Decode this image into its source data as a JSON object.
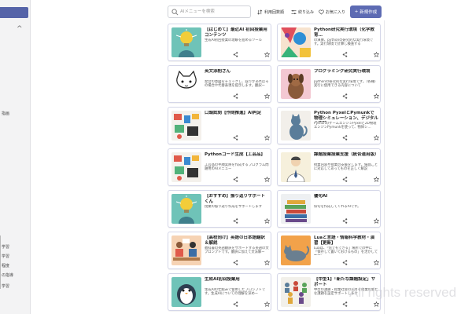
{
  "sidebar": {
    "items": [
      {
        "label": "学習"
      },
      {
        "label": "学習"
      },
      {
        "label": "程度"
      },
      {
        "label": "の指導"
      },
      {
        "label": "学習"
      }
    ],
    "fragment": "指画"
  },
  "search": {
    "placeholder": "AIメニューを検索"
  },
  "toolbar": {
    "history_label": "利用回数順",
    "filter_label": "絞り込み",
    "favorites_label": "お気に入り",
    "new_label": "新規作成"
  },
  "cards": [
    {
      "title": "【はじめて】最近AI 初回授業用コンテンツ",
      "description": "生成AI初回授業の理解を進めるツール",
      "icon": "lightbulb-head-icon"
    },
    {
      "title": "Python研究実行環境（化学教育…",
      "description": "の演算、pythonの研究的な実行環境です。実行環境で計算し検査する",
      "icon": "abstract-art-icon"
    },
    {
      "title": "英文添削さん",
      "description": "発音の意図をチェックし、誤りがあればその場合や代替表現を提示します。翻訳ー",
      "icon": "cat-icon"
    },
    {
      "title": "プログラミング研究実行環境",
      "description": "pythonの研究的な実行環境です。（各種）実行に使用できる内容について",
      "icon": "dog-icon"
    },
    {
      "title": "口頭試問【作問推進】AI判定",
      "description": "",
      "icon": "study-desk-icon"
    },
    {
      "title": "Python PyxelとPymunkで物理シミュレーション、デジタルの実験ー",
      "description": "PythonのゲームエンジンPyxelと2D物理エンジンPymunkを使って、物体シ…",
      "icon": "cat-sitting-icon"
    },
    {
      "title": "Pythonコード生成【工芸品】",
      "description": "工芸品の手順実際を作成するプログラム問題用のAIメニュー",
      "icon": "study-desk-icon"
    },
    {
      "title": "課題授業授業支援（統合運用版）",
      "description": "授業内容や授業の支援をします。場面ごとに対応してあってものを正しく解説",
      "icon": "teacher-icon"
    },
    {
      "title": "【おすすめ】振り返りサポートくん",
      "description": "授業の振り返り作成をサポートします",
      "icon": "lightbulb-head-icon"
    },
    {
      "title": "優句AI",
      "description": "俳句を作成してくれるAIです。",
      "icon": "books-icon"
    },
    {
      "title": "【高校向け】英語の日本語翻訳＆解説",
      "description": "教科書の英語翻訳をサポートする英語の文プロンプトです。翻訳に加えて文法解ー",
      "icon": "classroom-icon"
    },
    {
      "title": "Luaと言語・情報科学教材・演習【更新】",
      "description": "Luaは、「何でもできる」場所での中に「保存して置いておけるもの」を活かして整理し",
      "icon": "cat-lying-icon"
    },
    {
      "title": "生成AI初回授業用",
      "description": "生成AIの仕組みで使用したプロンプトです。生成AIについての理解を深めー",
      "icon": "penguin-icon"
    },
    {
      "title": "【中型1】「新たな課題設定」サポート",
      "description": "中型の課題・授業社会の先月を授業の新たな課題を設定サポートします",
      "icon": "crowd-icon"
    }
  ],
  "watermark": "All rights reserved",
  "colors": {
    "accent": "#5d6bb3",
    "sidebar_highlight": "#5563a8",
    "sidebar_bg": "#f3f3f4"
  }
}
